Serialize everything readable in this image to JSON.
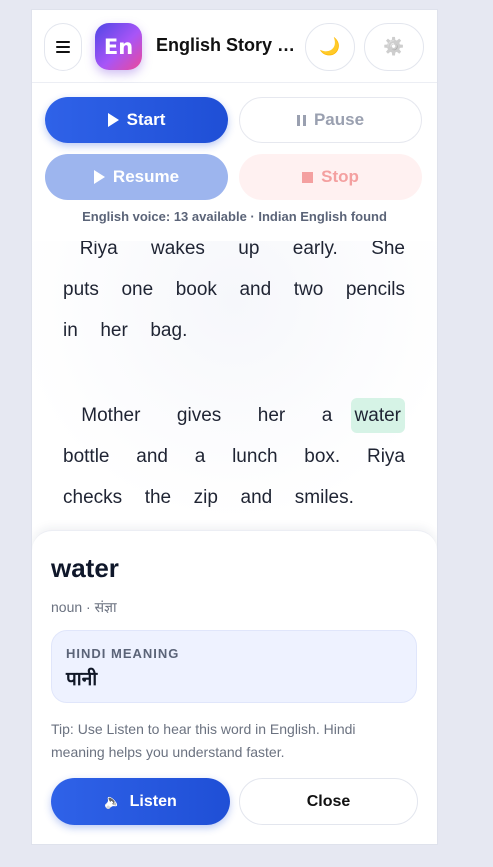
{
  "header": {
    "logo_text": "En",
    "title": "English Story Reader",
    "icons": {
      "menu": "hamburger-menu-icon",
      "theme": "moon-icon",
      "settings": "gear-icon"
    },
    "moon_glyph": "🌙",
    "gear_glyph": "⚙️"
  },
  "controls": {
    "start_label": "Start",
    "pause_label": "Pause",
    "resume_label": "Resume",
    "stop_label": "Stop",
    "voice_status": "English voice: 13 available · Indian English found",
    "colors": {
      "primary": "#2f62e8",
      "disabled_primary": "#9db5ee",
      "stop_bg": "#fff1f1",
      "stop_text": "#f4a0a0"
    }
  },
  "story": {
    "para1": " Riya  wakes  up  early.  She  puts  one  book  and  two  pencils  in  her  bag.",
    "para2_before": " Mother  gives  her  a ",
    "para2_highlight": "water",
    "para2_after": " bottle  and  a  lunch  box.  Riya  checks  the  zip  and  smiles.",
    "highlight_color": "#d6f3e6"
  },
  "word_sheet": {
    "word": "water",
    "part_of_speech": "noun · संज्ञा",
    "meaning_label": "HINDI MEANING",
    "meaning_value": "पानी",
    "tip": "Tip: Use Listen to hear this word in English. Hindi meaning helps you understand faster.",
    "listen_label": "Listen",
    "close_label": "Close",
    "speaker_glyph": "🔈"
  }
}
